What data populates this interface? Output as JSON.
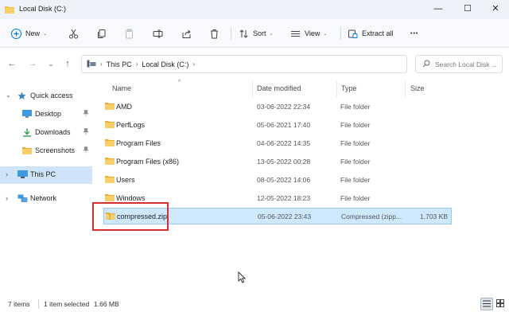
{
  "window": {
    "title": "Local Disk (C:)",
    "min_glyph": "—",
    "max_glyph": "☐",
    "close_glyph": "✕"
  },
  "toolbar": {
    "new_label": "New",
    "sort_label": "Sort",
    "view_label": "View",
    "extract_label": "Extract all",
    "more_glyph": "•••",
    "caret": "⌄"
  },
  "nav": {
    "back_glyph": "←",
    "forward_glyph": "→",
    "recent_glyph": "⌄",
    "up_glyph": "↑"
  },
  "address": {
    "crumbs": [
      "This PC",
      "Local Disk (C:)"
    ],
    "separator": "›"
  },
  "search": {
    "placeholder": "Search Local Disk ..."
  },
  "sidebar": {
    "items": [
      {
        "label": "Quick access",
        "icon": "star-icon"
      },
      {
        "label": "Desktop",
        "icon": "desktop-icon"
      },
      {
        "label": "Downloads",
        "icon": "download-icon"
      },
      {
        "label": "Screenshots",
        "icon": "folder-icon"
      },
      {
        "label": "This PC",
        "icon": "computer-icon"
      },
      {
        "label": "Network",
        "icon": "network-icon"
      }
    ]
  },
  "columns": {
    "name": "Name",
    "date": "Date modified",
    "type": "Type",
    "size": "Size",
    "sort_glyph": "^"
  },
  "files": [
    {
      "name": "AMD",
      "date": "03-06-2022 22:34",
      "type": "File folder",
      "size": ""
    },
    {
      "name": "PerfLogs",
      "date": "05-06-2021 17:40",
      "type": "File folder",
      "size": ""
    },
    {
      "name": "Program Files",
      "date": "04-06-2022 14:35",
      "type": "File folder",
      "size": ""
    },
    {
      "name": "Program Files (x86)",
      "date": "13-05-2022 00:28",
      "type": "File folder",
      "size": ""
    },
    {
      "name": "Users",
      "date": "08-05-2022 14:06",
      "type": "File folder",
      "size": ""
    },
    {
      "name": "Windows",
      "date": "12-05-2022 18:23",
      "type": "File folder",
      "size": ""
    },
    {
      "name": "compressed.zip",
      "date": "05-06-2022 23:43",
      "type": "Compressed (zipp...",
      "size": "1,703 KB"
    }
  ],
  "status": {
    "count": "7 items",
    "selected": "1 item selected",
    "size": "1.66 MB"
  },
  "colors": {
    "selection_bg": "#cde8ff",
    "highlight_border": "#d32f2f",
    "folder_yellow": "#f5c04a",
    "accent": "#0078d4"
  }
}
